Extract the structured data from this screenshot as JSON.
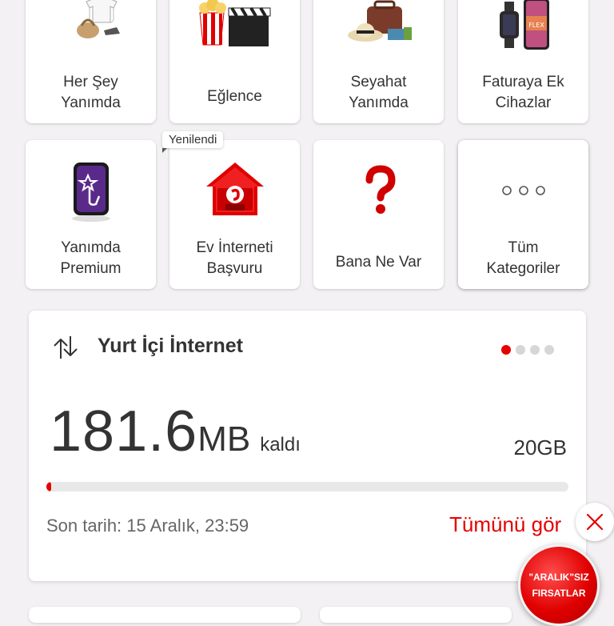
{
  "categories": [
    {
      "label": "Her Şey\nYanımda",
      "icon": "bag-and-clothes-icon"
    },
    {
      "label": "Eğlence",
      "icon": "popcorn-clapper-icon"
    },
    {
      "label": "Seyahat\nYanımda",
      "icon": "travel-bag-icon"
    },
    {
      "label": "Faturaya Ek\nCihazlar",
      "icon": "devices-icon"
    },
    {
      "label": "Yanımda\nPremium",
      "icon": "premium-star-icon"
    },
    {
      "label": "Ev İnterneti\nBaşvuru",
      "icon": "home-internet-icon"
    },
    {
      "label": "Bana Ne Var",
      "icon": "question-mark-icon"
    },
    {
      "label": "Tüm\nKategoriler",
      "icon": "more-dots-icon"
    }
  ],
  "badge": {
    "label": "Yenilendi"
  },
  "usage_card": {
    "title": "Yurt İçi İnternet",
    "remaining_value": "181.6",
    "remaining_unit": "MB",
    "remaining_suffix": "kaldı",
    "total": "20GB",
    "progress_fraction": 0.009,
    "deadline": "Son tarih: 15 Aralık, 23:59",
    "see_all": "Tümünü gör",
    "carousel_dots": 4,
    "active_dot": 0
  },
  "promo": {
    "line1": "\"ARALIK\"SIZ",
    "line2": "FIRSATLAR"
  },
  "colors": {
    "accent": "#e60000",
    "background": "#f3f1f3"
  }
}
